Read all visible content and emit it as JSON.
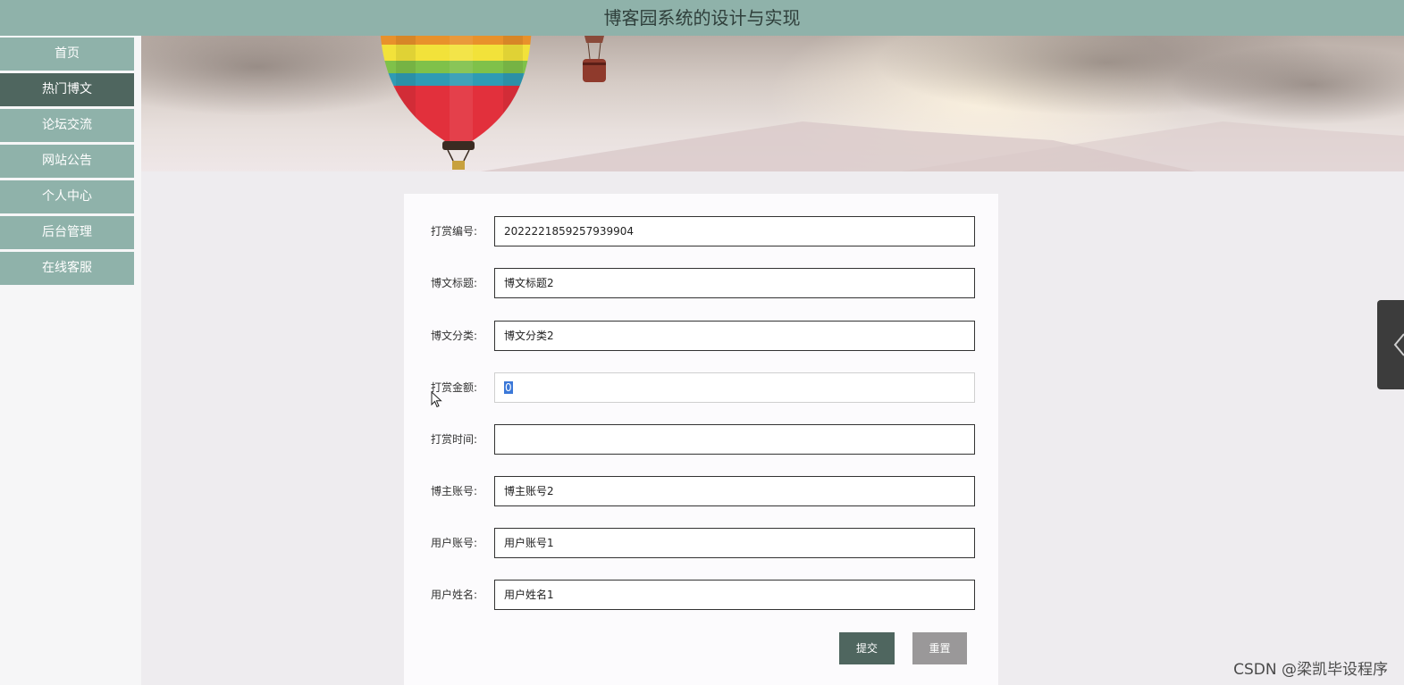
{
  "header": {
    "title": "博客园系统的设计与实现"
  },
  "sidebar": {
    "items": [
      {
        "label": "首页"
      },
      {
        "label": "热门博文"
      },
      {
        "label": "论坛交流"
      },
      {
        "label": "网站公告"
      },
      {
        "label": "个人中心"
      },
      {
        "label": "后台管理"
      },
      {
        "label": "在线客服"
      }
    ],
    "active_label": "热门博文"
  },
  "form": {
    "fields": [
      {
        "label": "打赏编号:",
        "value": "2022221859257939904"
      },
      {
        "label": "博文标题:",
        "value": "博文标题2"
      },
      {
        "label": "博文分类:",
        "value": "博文分类2"
      },
      {
        "label": "打赏金额:",
        "value": "0"
      },
      {
        "label": "打赏时间:",
        "value": ""
      },
      {
        "label": "博主账号:",
        "value": "博主账号2"
      },
      {
        "label": "用户账号:",
        "value": "用户账号1"
      },
      {
        "label": "用户姓名:",
        "value": "用户姓名1"
      }
    ],
    "submit_label": "提交",
    "reset_label": "重置"
  },
  "icons": {
    "side_tab": "chevron-left-icon",
    "cursor": "mouse-pointer-icon"
  },
  "colors": {
    "header_bg": "#8fb2aa",
    "nav_bg": "#8fb2aa",
    "nav_active_bg": "#4f665f",
    "submit_bg": "#4f665f",
    "reset_bg": "#9a9899"
  },
  "watermark": {
    "text": "CSDN @梁凯毕设程序"
  }
}
